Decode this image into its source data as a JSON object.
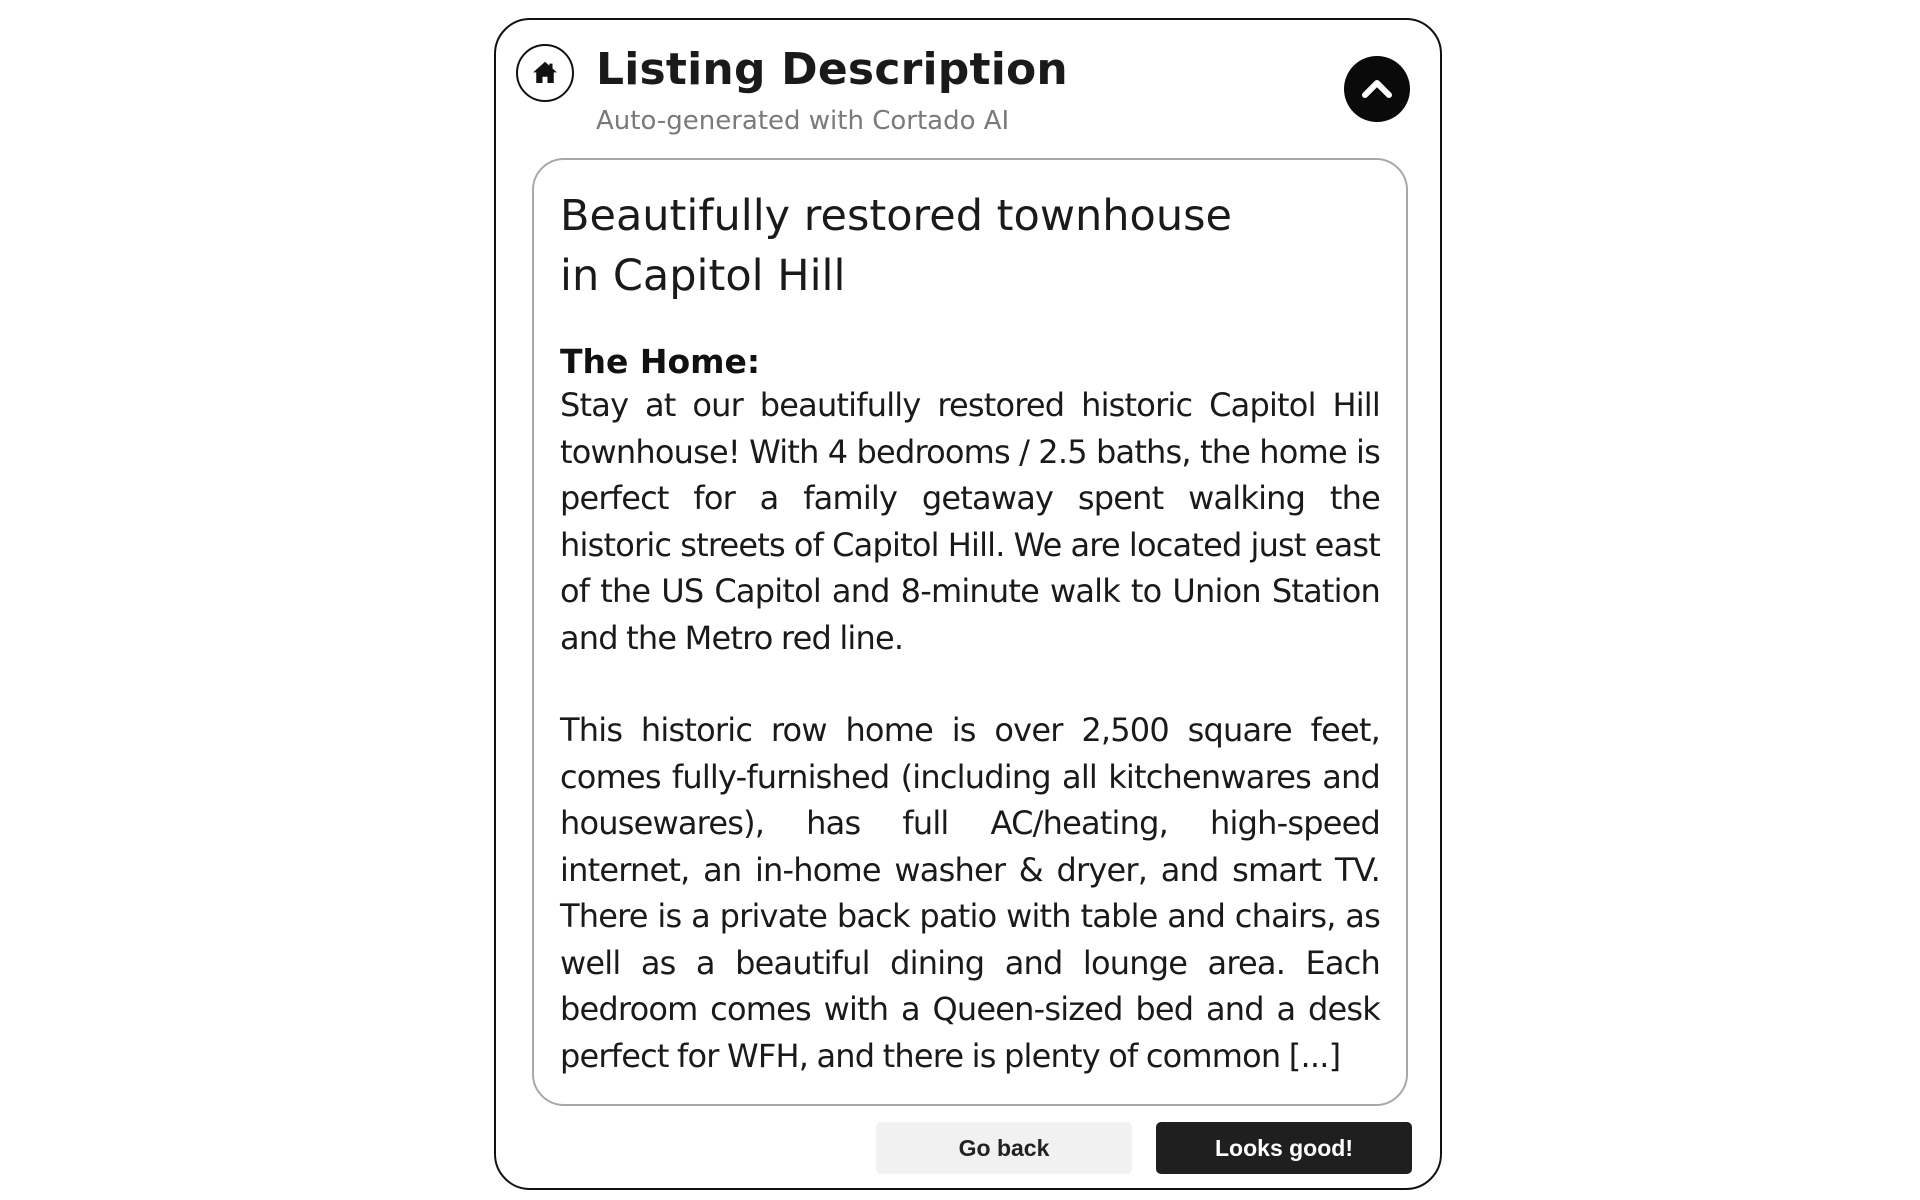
{
  "header": {
    "title": "Listing Description",
    "subtitle": "Auto-generated with Cortado AI",
    "home_icon": "home-icon",
    "collapse_icon": "chevron-up-icon"
  },
  "listing": {
    "title": "Beautifully restored townhouse in Capitol Hill",
    "section_heading": "The Home:",
    "paragraphs": [
      "Stay at our beautifully restored historic Capitol Hill townhouse! With 4 bedrooms / 2.5 baths, the home is perfect for a family getaway spent walking the historic streets of Capitol Hill. We are located just east of the US Capitol and 8-minute walk to Union Station and the Metro red line.",
      "This historic row home is over 2,500 square feet, comes fully-furnished (including all kitchenwares and housewares), has full AC/heating, high-speed internet, an in-home washer & dryer, and smart TV. There is a private back patio with table and chairs, as well as a beautiful dining and lounge area. Each bedroom comes with a Queen-sized bed and a desk perfect for WFH, and there is plenty of common [...]"
    ]
  },
  "actions": {
    "back_label": "Go back",
    "confirm_label": "Looks good!"
  },
  "colors": {
    "primary_button": "#1f1f1f",
    "secondary_button": "#f1f1f1",
    "subtitle_text": "#7a7a7a",
    "box_border": "#a8a8a8"
  }
}
